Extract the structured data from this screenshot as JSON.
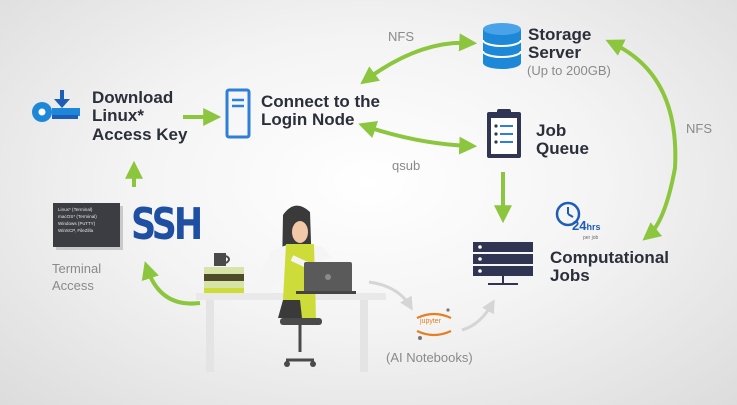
{
  "nodes": {
    "download": {
      "line1": "Download",
      "line2": "Linux*",
      "line3": "Access Key"
    },
    "login": {
      "line1": "Connect to the",
      "line2": "Login Node"
    },
    "storage": {
      "line1": "Storage",
      "line2": "Server",
      "sub": "(Up to 200GB)"
    },
    "queue": {
      "line1": "Job",
      "line2": "Queue"
    },
    "compute": {
      "line1": "Computational",
      "line2": "Jobs"
    },
    "terminal": {
      "line1": "Terminal",
      "line2": "Access"
    },
    "notebooks": {
      "label": "(AI Notebooks)"
    }
  },
  "edges": {
    "nfs_top": "NFS",
    "nfs_right": "NFS",
    "qsub": "qsub"
  },
  "ssh": {
    "label": "SSH"
  },
  "terminal_screen": {
    "lines": [
      "Linux* (Terminal)",
      "macOS* (Terminal)",
      "Windows (PuTTY)",
      "WinSCP, FileZilla"
    ]
  },
  "time_badge": {
    "value": "24",
    "unit": "hrs",
    "note": "per job"
  },
  "jupyter": {
    "label": "jupyter"
  },
  "icons": {
    "key": "key-download-icon",
    "server": "server-tower-icon",
    "database": "database-icon",
    "clipboard": "clipboard-list-icon",
    "clock": "clock-icon",
    "rack": "server-rack-icon",
    "person": "person-at-laptop-illustration"
  },
  "colors": {
    "arrow_green": "#8cc63f",
    "brand_blue": "#1d5db8",
    "dark_text": "#2b2f3a",
    "grey_text": "#8a8a8a",
    "navy_icon": "#2f3552"
  }
}
